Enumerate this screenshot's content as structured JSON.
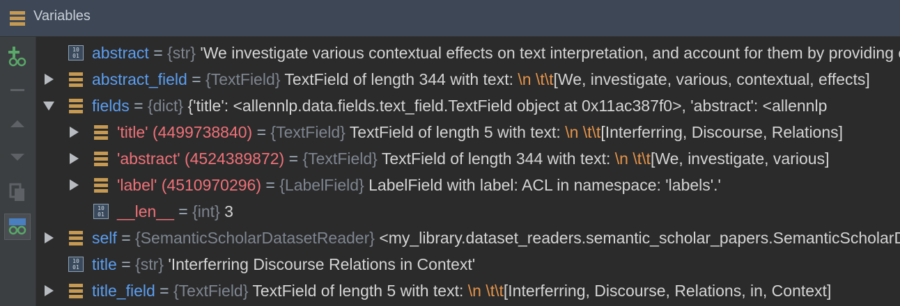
{
  "panel": {
    "title": "Variables"
  },
  "sidebar": {
    "buttons": [
      {
        "name": "add-watch-icon"
      },
      {
        "name": "remove-watch-icon"
      },
      {
        "name": "move-up-icon"
      },
      {
        "name": "move-down-icon"
      },
      {
        "name": "copy-watch-icon"
      },
      {
        "name": "show-watches-icon"
      }
    ]
  },
  "rows": [
    {
      "expander": "none",
      "icon": "primitive",
      "indent": 0,
      "name": "abstract",
      "name_style": "blue",
      "eq": "=",
      "type": "{str}",
      "value": " 'We investigate various contextual effects on text interpretation, and account for them by providing contextual constraints in terms of discourse relations'"
    },
    {
      "expander": "collapsed",
      "icon": "struct",
      "indent": 0,
      "name": "abstract_field",
      "name_style": "blue",
      "eq": "=",
      "type": "{TextField}",
      "value": " TextField of length 344 with text: ",
      "esc": "\\n \\t\\t",
      "value2": "[We, investigate, various, contextual, effects]"
    },
    {
      "expander": "expanded",
      "icon": "struct",
      "indent": 0,
      "name": "fields",
      "name_style": "blue",
      "eq": "=",
      "type": "{dict}",
      "value": " {'title': <allennlp.data.fields.text_field.TextField object at 0x11ac387f0>, 'abstract': <allennlp"
    },
    {
      "expander": "collapsed",
      "icon": "struct",
      "indent": 1,
      "name": "'title' (4499738840)",
      "name_style": "red",
      "eq": "=",
      "type": "{TextField}",
      "value": " TextField of length 5 with text: ",
      "esc": "\\n \\t\\t",
      "value2": "[Interferring, Discourse, Relations]"
    },
    {
      "expander": "collapsed",
      "icon": "struct",
      "indent": 1,
      "name": "'abstract' (4524389872)",
      "name_style": "red",
      "eq": "=",
      "type": "{TextField}",
      "value": " TextField of length 344 with text: ",
      "esc": "\\n \\t\\t",
      "value2": "[We, investigate, various]"
    },
    {
      "expander": "collapsed",
      "icon": "struct",
      "indent": 1,
      "name": "'label' (4510970296)",
      "name_style": "red",
      "eq": "=",
      "type": "{LabelField}",
      "value": " LabelField with label: ACL in namespace: 'labels'.'"
    },
    {
      "expander": "none",
      "icon": "primitive",
      "indent": 1,
      "name": "__len__",
      "name_style": "red",
      "eq": "=",
      "type": "{int}",
      "value": " 3"
    },
    {
      "expander": "collapsed",
      "icon": "struct",
      "indent": 0,
      "name": "self",
      "name_style": "blue",
      "eq": "=",
      "type": "{SemanticScholarDatasetReader}",
      "value": " <my_library.dataset_readers.semantic_scholar_papers.SemanticScholarDatasetReader>"
    },
    {
      "expander": "none",
      "icon": "primitive",
      "indent": 0,
      "name": "title",
      "name_style": "blue",
      "eq": "=",
      "type": "{str}",
      "value": " 'Interferring Discourse Relations in Context'"
    },
    {
      "expander": "collapsed",
      "icon": "struct",
      "indent": 0,
      "name": "title_field",
      "name_style": "blue",
      "eq": "=",
      "type": "{TextField}",
      "value": " TextField of length 5 with text: ",
      "esc": "\\n \\t\\t",
      "value2": "[Interferring, Discourse, Relations, in, Context]"
    }
  ]
}
